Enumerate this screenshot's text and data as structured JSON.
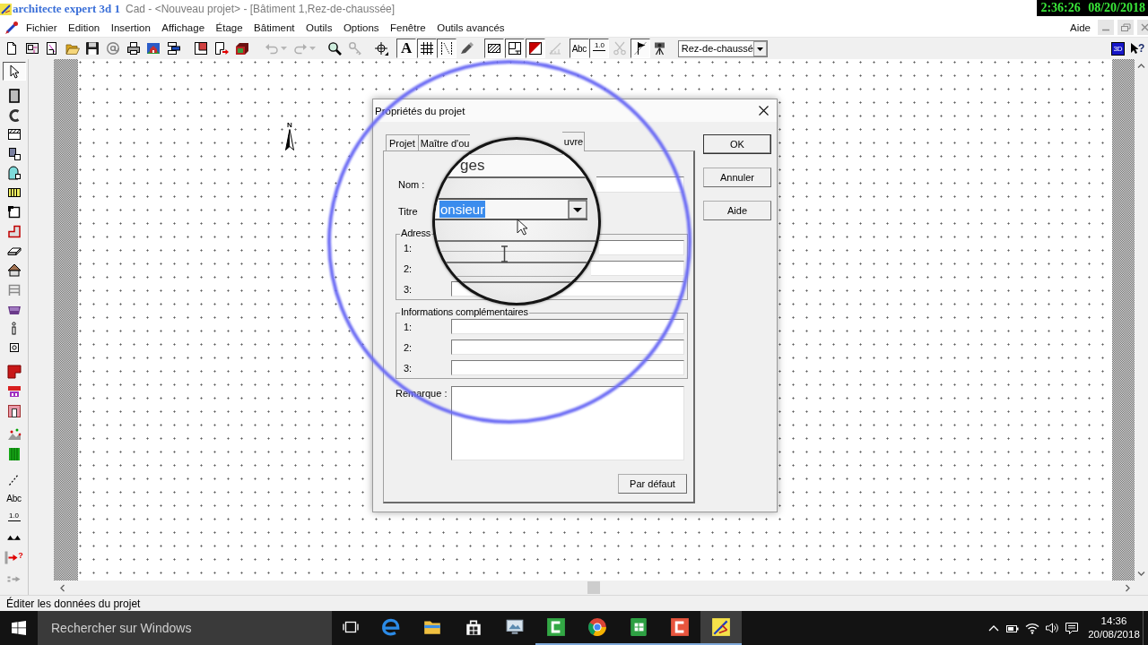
{
  "recording_overlay": {
    "channel_label": "architecte expert 3d 1",
    "timestamp": "2:36:26 08/20/2018"
  },
  "window": {
    "title": "Cad - <Nouveau projet> - [Bâtiment 1,Rez-de-chaussée]"
  },
  "menu_bar": {
    "items": [
      "Fichier",
      "Edition",
      "Insertion",
      "Affichage",
      "Étage",
      "Bâtiment",
      "Outils",
      "Options",
      "Fenêtre",
      "Outils avancés"
    ],
    "help": "Aide"
  },
  "toolbar": {
    "buttons": [
      {
        "pressed": false,
        "disabled": false
      },
      {
        "pressed": false,
        "disabled": false
      },
      {
        "pressed": false,
        "disabled": false
      },
      {
        "pressed": false,
        "disabled": false
      },
      {
        "pressed": false,
        "disabled": false
      },
      {
        "pressed": false,
        "disabled": false
      },
      {
        "pressed": false,
        "disabled": false
      },
      {
        "pressed": false,
        "disabled": false
      },
      {
        "pressed": false,
        "disabled": false
      },
      {
        "pressed": false,
        "disabled": false
      },
      {
        "pressed": false,
        "disabled": false
      },
      {
        "pressed": false,
        "disabled": false
      },
      {
        "pressed": false,
        "disabled": true
      },
      {
        "pressed": false,
        "disabled": true
      },
      {
        "pressed": false,
        "disabled": false
      },
      {
        "pressed": false,
        "disabled": true
      },
      {
        "pressed": false,
        "disabled": false
      },
      {
        "pressed": true,
        "disabled": false,
        "label": "A"
      },
      {
        "pressed": true,
        "disabled": false
      },
      {
        "pressed": true,
        "disabled": false
      },
      {
        "pressed": false,
        "disabled": false
      },
      {
        "pressed": true,
        "disabled": false
      },
      {
        "pressed": true,
        "disabled": false
      },
      {
        "pressed": true,
        "disabled": false
      },
      {
        "pressed": false,
        "disabled": true
      },
      {
        "pressed": true,
        "disabled": false,
        "label": "Abc"
      },
      {
        "pressed": true,
        "disabled": false,
        "label": "1.0"
      },
      {
        "pressed": false,
        "disabled": true
      },
      {
        "pressed": true,
        "disabled": false
      },
      {
        "pressed": false,
        "disabled": false
      }
    ],
    "level_select": {
      "value": "Rez-de-chaussé"
    },
    "view_3d": "3D",
    "help_pointer": "?"
  },
  "tool_palette": {
    "tools": [
      {
        "selected": true
      },
      {
        "selected": false
      },
      {
        "selected": false
      },
      {
        "selected": false
      },
      {
        "selected": false
      },
      {
        "selected": false
      },
      {
        "selected": false
      },
      {
        "selected": false
      },
      {
        "selected": false
      },
      {
        "selected": false
      },
      {
        "selected": false
      },
      {
        "selected": false
      },
      {
        "selected": false
      },
      {
        "selected": false
      },
      {
        "selected": false
      },
      {
        "selected": false
      },
      {
        "selected": false
      },
      {
        "selected": false
      },
      {
        "selected": false
      },
      {
        "selected": false
      },
      {
        "selected": false
      },
      {
        "selected": false,
        "label": "Abc"
      },
      {
        "selected": false,
        "label": "1.0"
      },
      {
        "selected": false
      },
      {
        "selected": false,
        "label": "?"
      },
      {
        "selected": false
      }
    ]
  },
  "canvas": {
    "north_label": "N"
  },
  "dialog": {
    "title": "Propriétés du projet",
    "tabs": [
      {
        "label": "Projet",
        "selected": false
      },
      {
        "label": "Maître d'ou",
        "selected": false
      },
      {
        "label": "uvre",
        "selected": true
      }
    ],
    "name_label": "Nom :",
    "title_label": "Titre",
    "groups": [
      {
        "label": "Adress",
        "rows": [
          "1:",
          "2:",
          "3:"
        ]
      },
      {
        "label": "Informations complémentaires",
        "rows": [
          "1:",
          "2:",
          "3:"
        ]
      }
    ],
    "remark_label": "Remarque :",
    "default_button": "Par défaut",
    "buttons": [
      {
        "label": "OK",
        "default": true
      },
      {
        "label": "Annuler",
        "default": false
      },
      {
        "label": "Aide",
        "default": false
      }
    ]
  },
  "magnifier": {
    "name_value": "ges",
    "title_value": "onsieur"
  },
  "status_bar": {
    "text": "Éditer les données du projet"
  },
  "taskbar": {
    "search": {
      "placeholder": "Rechercher sur Windows"
    },
    "apps": [
      {
        "running": false,
        "active": false
      },
      {
        "running": false,
        "active": false
      },
      {
        "running": false,
        "active": false
      },
      {
        "running": false,
        "active": false
      },
      {
        "running": true,
        "active": false
      },
      {
        "running": true,
        "active": false
      },
      {
        "running": true,
        "active": false
      },
      {
        "running": true,
        "active": false
      },
      {
        "running": true,
        "active": true
      }
    ],
    "clock": {
      "time": "14:36",
      "date": "20/08/2018"
    }
  }
}
